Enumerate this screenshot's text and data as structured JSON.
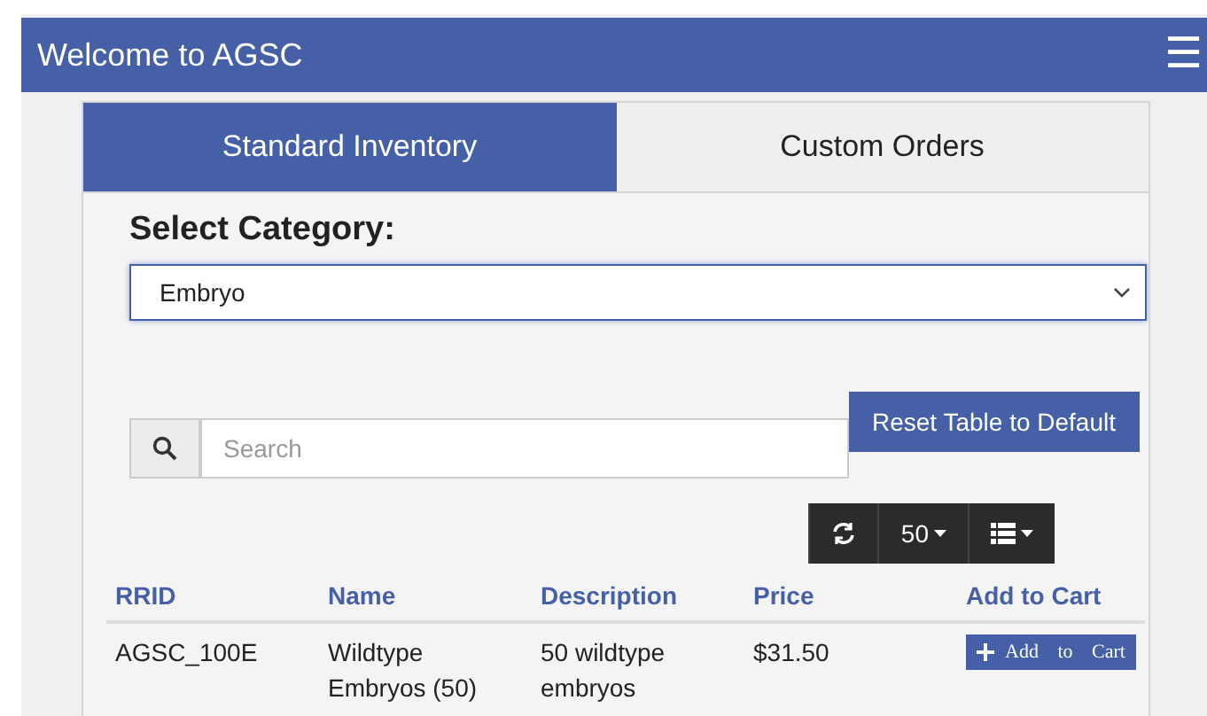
{
  "header": {
    "title": "Welcome to AGSC",
    "menu_icon": "☰"
  },
  "tabs": [
    {
      "label": "Standard Inventory",
      "selected": true
    },
    {
      "label": "Custom Orders",
      "selected": false
    }
  ],
  "category": {
    "label": "Select Category:",
    "value": "Embryo"
  },
  "search": {
    "placeholder": "Search"
  },
  "reset_button": "Reset Table to Default",
  "toolbar": {
    "page_size": "50"
  },
  "table": {
    "columns": [
      "RRID",
      "Name",
      "Description",
      "Price",
      "Add to Cart"
    ],
    "rows": [
      {
        "rrid": "AGSC_100E",
        "name": "Wildtype Embryos (50)",
        "description": "50 wildtype embryos",
        "price": "$31.50",
        "button": "Add to Cart"
      }
    ]
  }
}
